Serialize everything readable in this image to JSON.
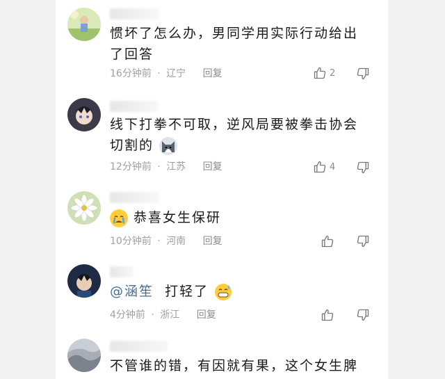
{
  "comments": [
    {
      "text": "惯坏了怎么办，男同学用实际行动给出了回答",
      "time": "16分钟前",
      "location": "辽宁",
      "reply": "回复",
      "likes": "2"
    },
    {
      "text": "线下打拳不可取，逆风局要被拳击协会切割的",
      "time": "12分钟前",
      "location": "江苏",
      "reply": "回复",
      "likes": "4"
    },
    {
      "text": "恭喜女生保研",
      "time": "10分钟前",
      "location": "河南",
      "reply": "回复",
      "likes": ""
    },
    {
      "mention": "@涵笙",
      "text": "打轻了",
      "time": "4分钟前",
      "location": "浙江",
      "reply": "回复",
      "likes": ""
    },
    {
      "text": "不管谁的错，有因就有果，这个女生脾气"
    }
  ],
  "meta_separator": "·",
  "icons": [
    "thumbs-up-icon",
    "thumbs-down-icon",
    "crying-emoji-icon",
    "grin-sweat-emoji-icon",
    "husky-emoji-icon"
  ]
}
